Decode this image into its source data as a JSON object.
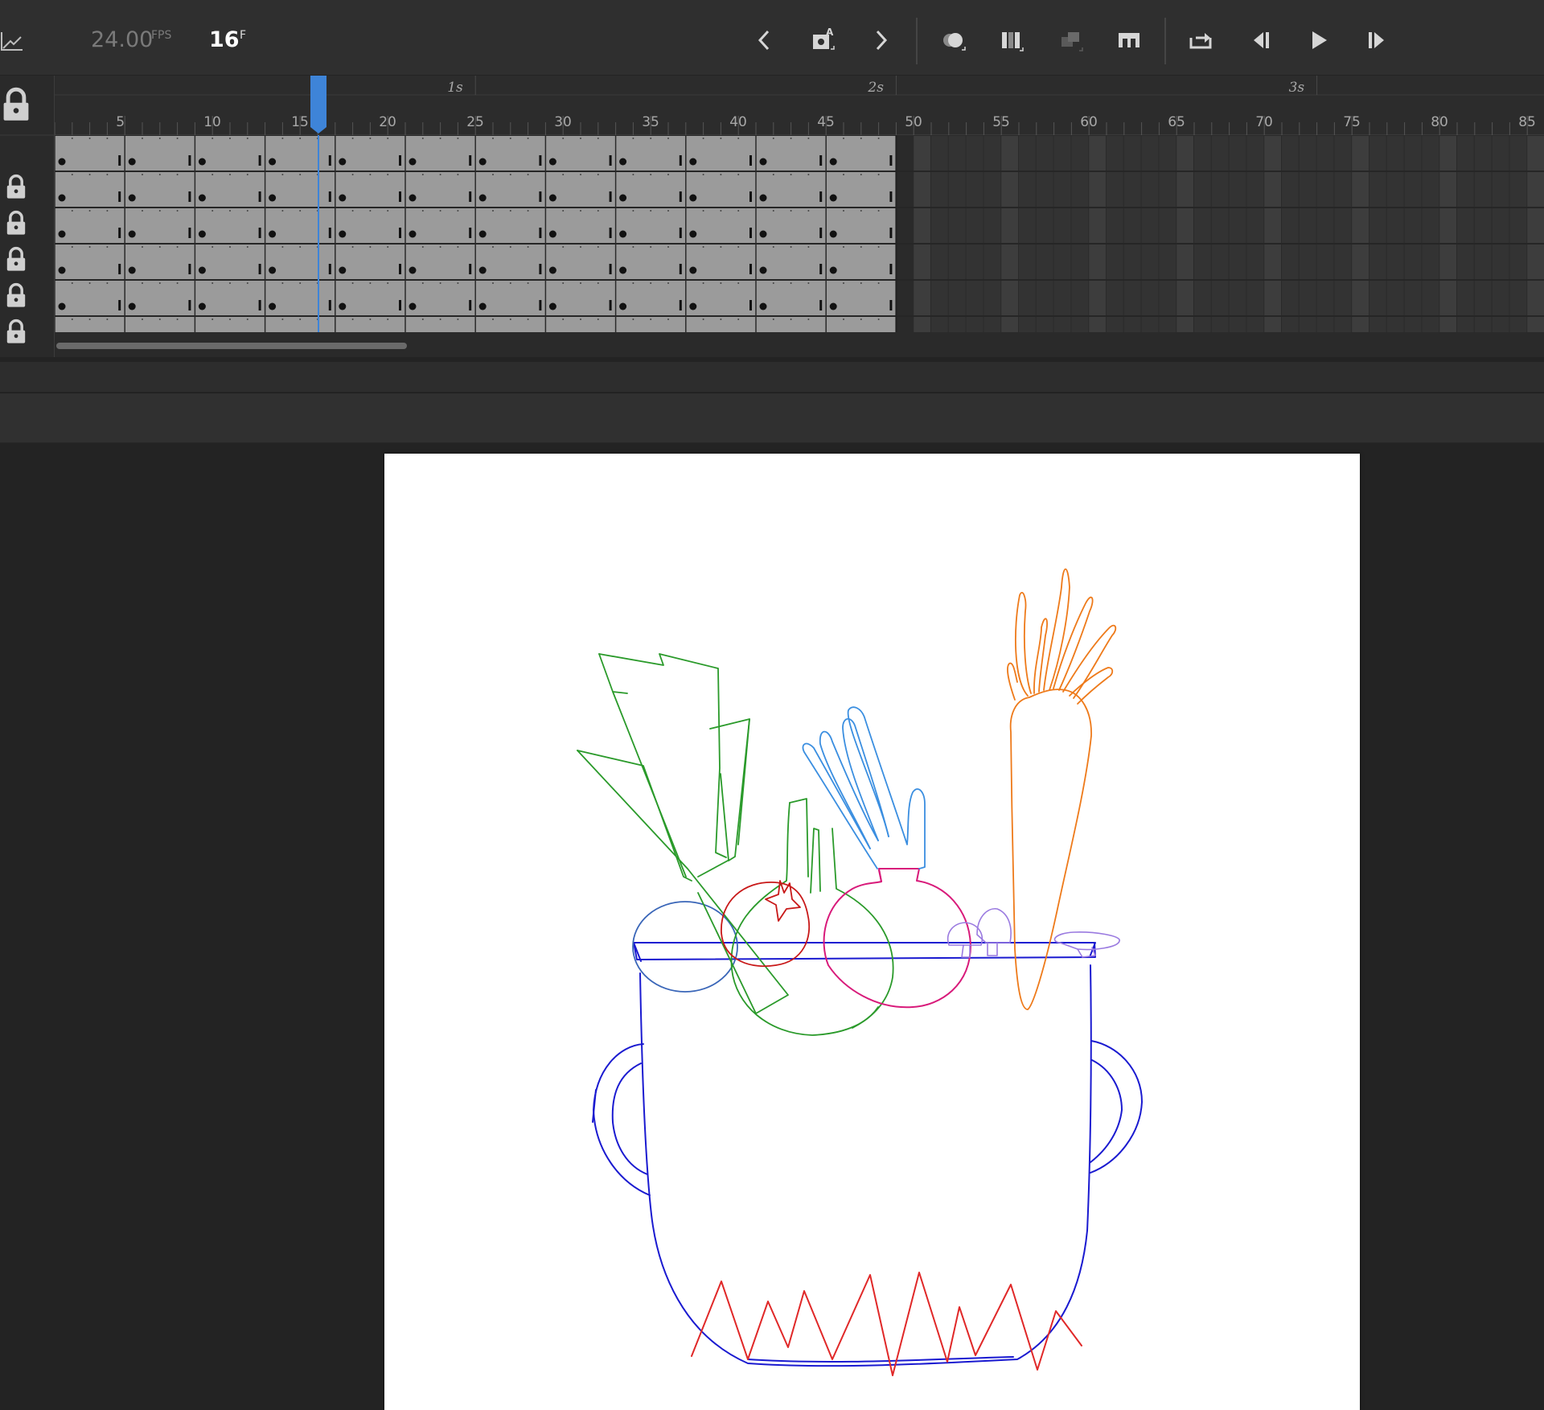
{
  "toolbar": {
    "fps_value": "24.00",
    "fps_unit": "FPS",
    "current_frame": "16",
    "frame_unit": "F",
    "buttons": [
      "previous-keyframe",
      "insert-keyframe",
      "next-keyframe",
      "onion-skin",
      "edit-multiple-frames",
      "loop-region",
      "center-frame",
      "loop",
      "step-back",
      "play",
      "step-forward"
    ]
  },
  "timeline": {
    "current_frame": 16,
    "total_frames_with_content": 48,
    "visible_frames": 86,
    "second_labels": [
      "1s",
      "2s",
      "3s"
    ],
    "frame_labels": [
      "5",
      "10",
      "15",
      "20",
      "25",
      "30",
      "35",
      "40",
      "45",
      "50",
      "55",
      "60",
      "65",
      "70",
      "75",
      "80",
      "85"
    ],
    "layers": [
      {
        "locked": false
      },
      {
        "locked": true
      },
      {
        "locked": true
      },
      {
        "locked": true
      },
      {
        "locked": true
      },
      {
        "locked": true
      }
    ],
    "keyframe_interval": 4,
    "colors": {
      "playhead": "#3e84d8",
      "frame_fill": "#9b9b9b",
      "frame_empty": "#333333",
      "frame_empty_alt": "#3d3d3d"
    }
  },
  "stage": {
    "background": "#ffffff",
    "stroke_colors": {
      "pot": "#1a1ad0",
      "flames": "#e02828",
      "leek": "#2a9a2a",
      "carrot": "#ee7a1a",
      "pomegranate": "#d81a7a",
      "fork": "#3a8ee0",
      "mushrooms": "#9a7ae0",
      "tomato": "#c81818",
      "cabbage": "#3a66b8"
    }
  }
}
